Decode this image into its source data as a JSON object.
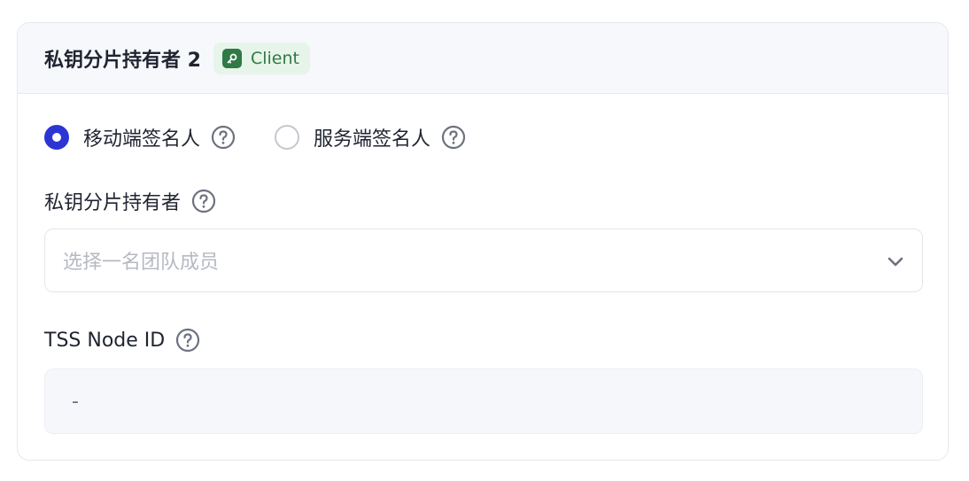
{
  "header": {
    "title": "私钥分片持有者 2",
    "badge": {
      "label": "Client",
      "icon": "key-icon",
      "color": "#2f7a45",
      "background": "#e7f4ea"
    }
  },
  "signer_type": {
    "options": [
      {
        "label": "移动端签名人",
        "selected": true
      },
      {
        "label": "服务端签名人",
        "selected": false
      }
    ],
    "accent": "#2c35d4"
  },
  "holder_field": {
    "label": "私钥分片持有者",
    "placeholder": "选择一名团队成员"
  },
  "node_id_field": {
    "label": "TSS Node ID",
    "value": "-"
  }
}
